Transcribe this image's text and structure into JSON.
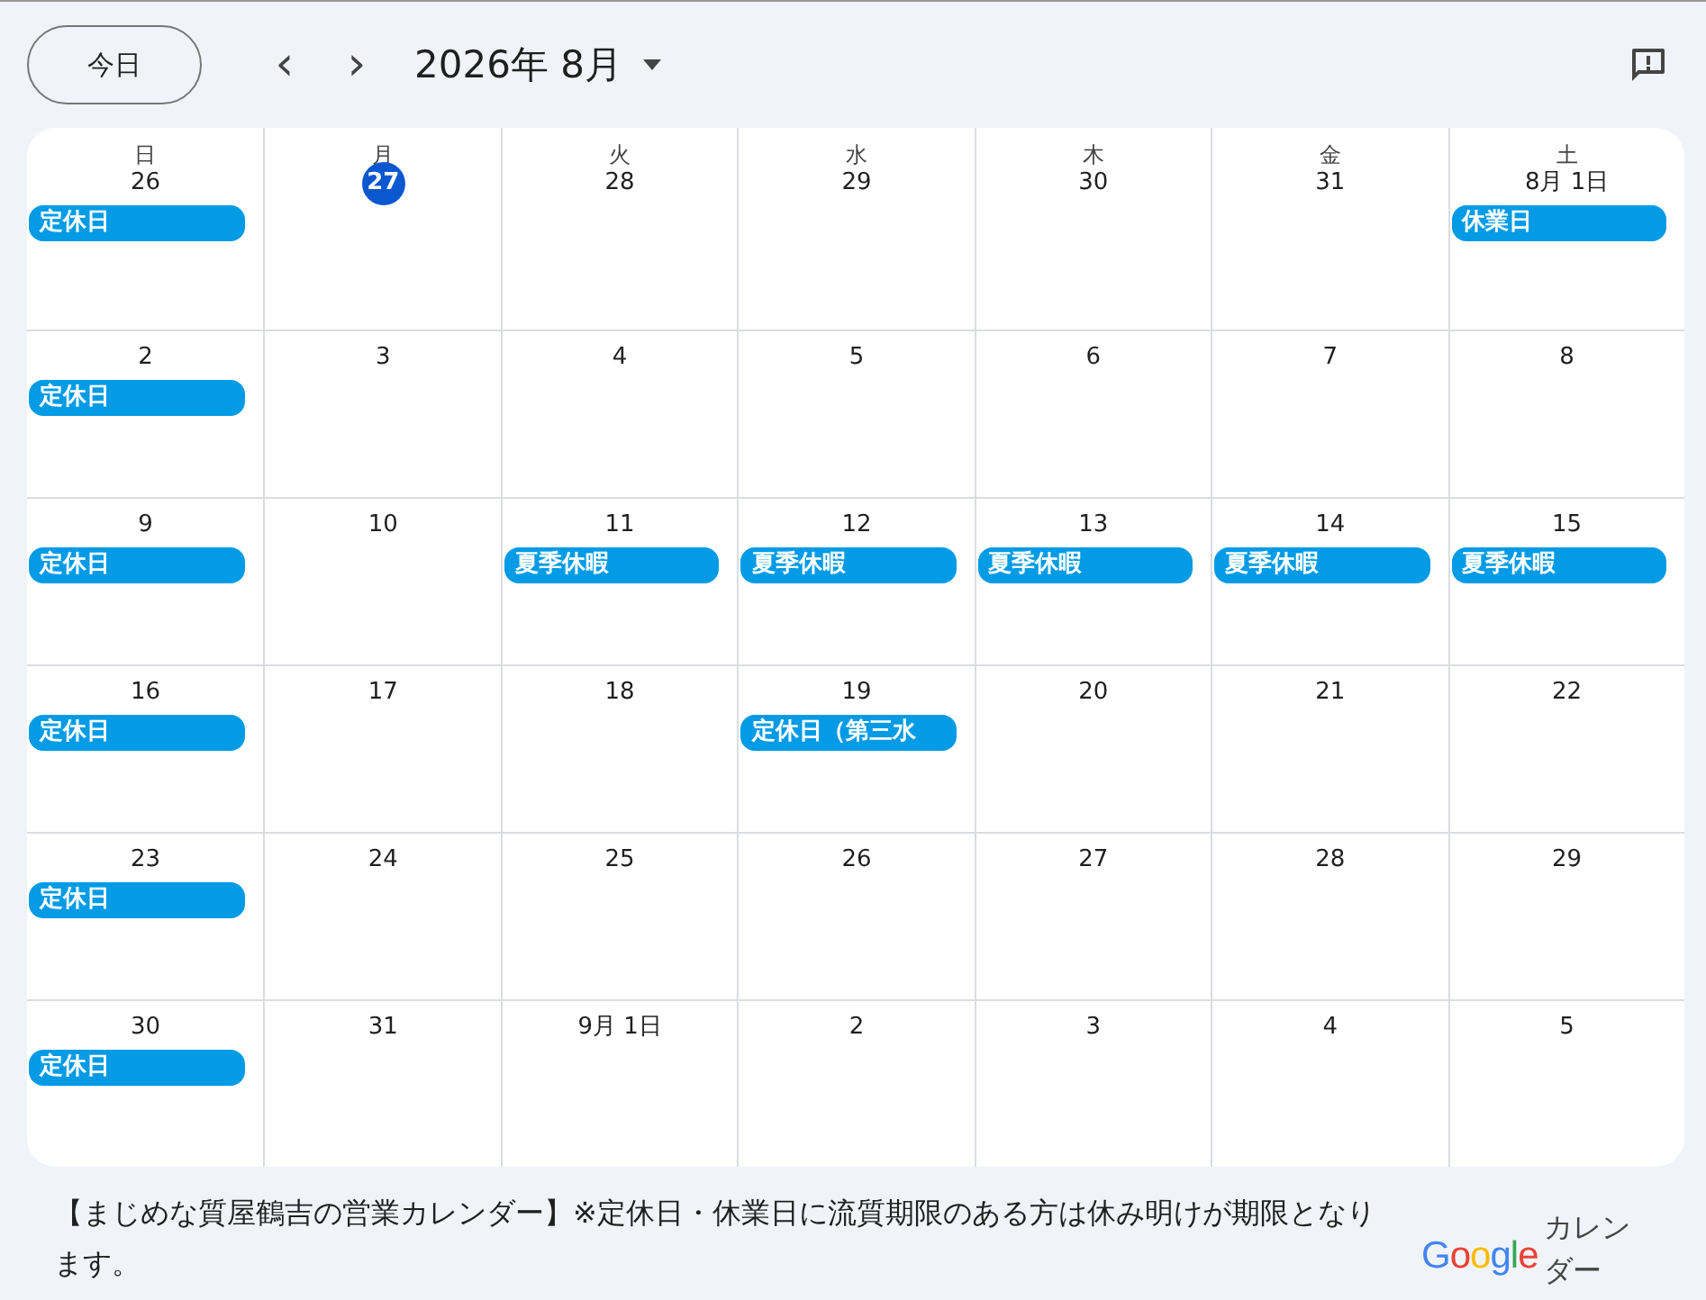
{
  "toolbar": {
    "today_button": "今日",
    "prev_button": "‹",
    "next_button": "›",
    "month_title": "2026年 8月"
  },
  "weekdays": [
    "日",
    "月",
    "火",
    "水",
    "木",
    "金",
    "土"
  ],
  "weeks": [
    {
      "days": [
        {
          "label": "26",
          "today": false,
          "events": [
            "定休日"
          ]
        },
        {
          "label": "27",
          "today": true
        },
        {
          "label": "28",
          "today": false
        },
        {
          "label": "29",
          "today": false
        },
        {
          "label": "30",
          "today": false
        },
        {
          "label": "31",
          "today": false
        },
        {
          "label": "8月 1日",
          "today": false,
          "events": [
            "休業日"
          ]
        }
      ]
    },
    {
      "days": [
        {
          "label": "2",
          "today": false,
          "events": [
            "定休日"
          ]
        },
        {
          "label": "3",
          "today": false
        },
        {
          "label": "4",
          "today": false
        },
        {
          "label": "5",
          "today": false
        },
        {
          "label": "6",
          "today": false
        },
        {
          "label": "7",
          "today": false
        },
        {
          "label": "8",
          "today": false
        }
      ]
    },
    {
      "days": [
        {
          "label": "9",
          "today": false,
          "events": [
            "定休日"
          ]
        },
        {
          "label": "10",
          "today": false
        },
        {
          "label": "11",
          "today": false,
          "events": [
            "夏季休暇"
          ]
        },
        {
          "label": "12",
          "today": false,
          "events": [
            "夏季休暇"
          ]
        },
        {
          "label": "13",
          "today": false,
          "events": [
            "夏季休暇"
          ]
        },
        {
          "label": "14",
          "today": false,
          "events": [
            "夏季休暇"
          ]
        },
        {
          "label": "15",
          "today": false,
          "events": [
            "夏季休暇"
          ]
        }
      ]
    },
    {
      "days": [
        {
          "label": "16",
          "today": false,
          "events": [
            "定休日"
          ]
        },
        {
          "label": "17",
          "today": false
        },
        {
          "label": "18",
          "today": false
        },
        {
          "label": "19",
          "today": false,
          "events": [
            "定休日（第三水"
          ]
        },
        {
          "label": "20",
          "today": false
        },
        {
          "label": "21",
          "today": false
        },
        {
          "label": "22",
          "today": false
        }
      ]
    },
    {
      "days": [
        {
          "label": "23",
          "today": false,
          "events": [
            "定休日"
          ]
        },
        {
          "label": "24",
          "today": false
        },
        {
          "label": "25",
          "today": false
        },
        {
          "label": "26",
          "today": false
        },
        {
          "label": "27",
          "today": false
        },
        {
          "label": "28",
          "today": false
        },
        {
          "label": "29",
          "today": false
        }
      ]
    },
    {
      "days": [
        {
          "label": "30",
          "today": false,
          "events": [
            "定休日"
          ]
        },
        {
          "label": "31",
          "today": false
        },
        {
          "label": "9月 1日",
          "today": false
        },
        {
          "label": "2",
          "today": false
        },
        {
          "label": "3",
          "today": false
        },
        {
          "label": "4",
          "today": false
        },
        {
          "label": "5",
          "today": false
        }
      ]
    }
  ],
  "footer": {
    "description": "【まじめな質屋鶴吉の営業カレンダー】※定休日・休業日に流質期限のある方は休み明けが期限となります。",
    "logo": "Google",
    "logo_caption": "カレンダー"
  }
}
